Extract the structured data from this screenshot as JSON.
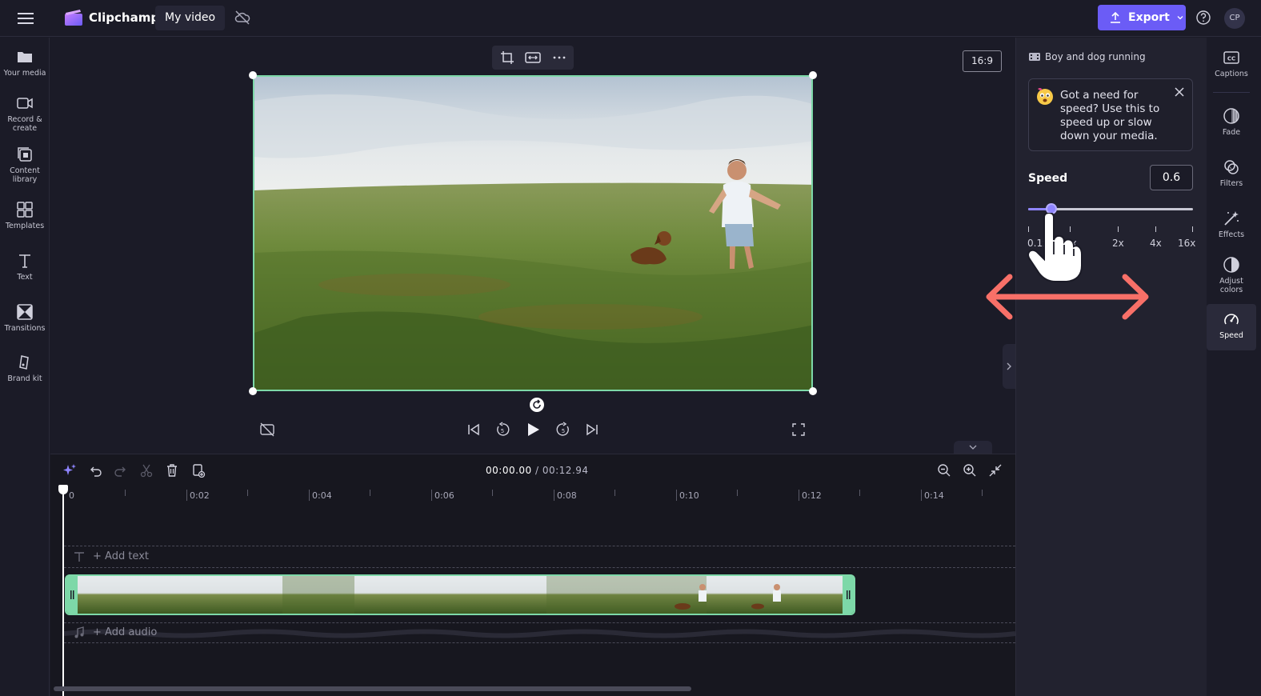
{
  "app": {
    "brand": "Clipchamp",
    "video_title": "My video",
    "export_label": "Export",
    "avatar_initials": "CP",
    "accent_color": "#6b5cf6",
    "selection_color": "#7dd8a8"
  },
  "left_sidebar": {
    "items": [
      {
        "label": "Your media",
        "icon": "folder-icon"
      },
      {
        "label": "Record &",
        "label2": "create",
        "icon": "camera-icon"
      },
      {
        "label": "Content",
        "label2": "library",
        "icon": "content-library-icon"
      },
      {
        "label": "Templates",
        "icon": "templates-icon"
      },
      {
        "label": "Text",
        "icon": "text-icon"
      },
      {
        "label": "Transitions",
        "icon": "transitions-icon"
      },
      {
        "label": "Brand kit",
        "icon": "brand-kit-icon"
      }
    ]
  },
  "preview": {
    "aspect_ratio": "16:9"
  },
  "timeline": {
    "current_time": "00:00.00",
    "duration": "/ 00:12.94",
    "ticks": [
      "0",
      "0:02",
      "0:04",
      "0:06",
      "0:08",
      "0:10",
      "0:12",
      "0:14"
    ],
    "add_text": "+ Add text",
    "add_audio": "+ Add audio"
  },
  "speed_panel": {
    "clip_name": "Boy and dog running",
    "tip": "Got a need for speed? Use this to speed up or slow down your media.",
    "label": "Speed",
    "value": "0.6",
    "slider_fraction": 0.14,
    "tick_labels": [
      "0.1x",
      "1x",
      "2x",
      "4x",
      "16x"
    ]
  },
  "right_rail": {
    "items": [
      {
        "label": "Captions",
        "icon": "captions-icon"
      },
      {
        "label": "Fade",
        "icon": "fade-icon"
      },
      {
        "label": "Filters",
        "icon": "filters-icon"
      },
      {
        "label": "Effects",
        "icon": "effects-icon"
      },
      {
        "label": "Adjust",
        "label2": "colors",
        "icon": "adjust-colors-icon"
      },
      {
        "label": "Speed",
        "icon": "speed-icon"
      }
    ]
  }
}
